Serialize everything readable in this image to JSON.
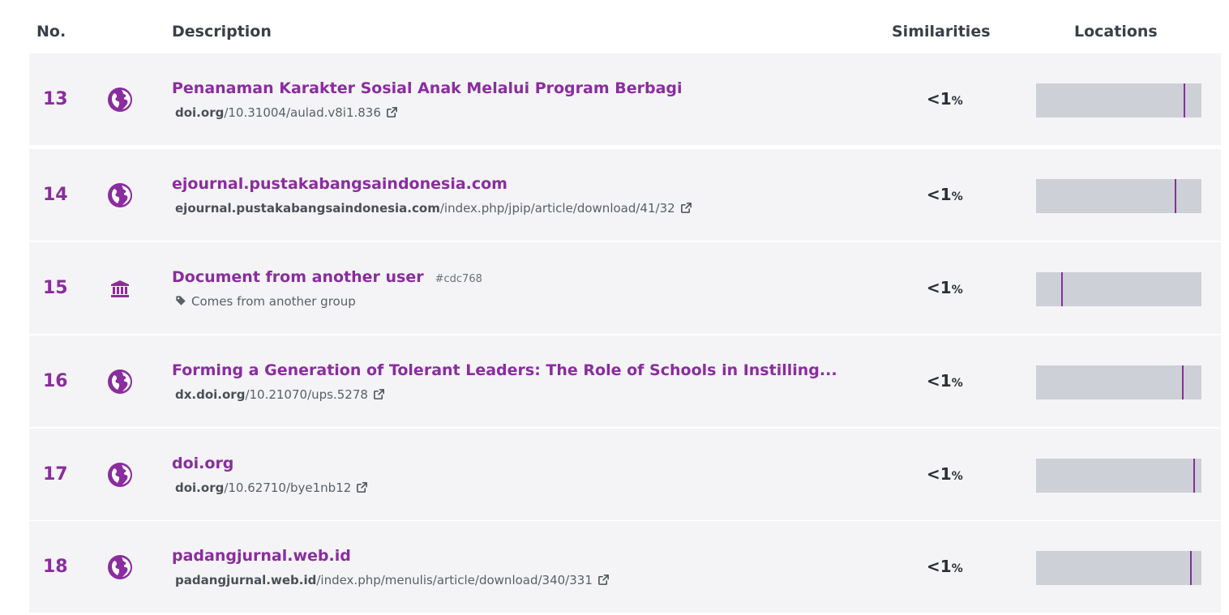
{
  "header": {
    "no": "No.",
    "description": "Description",
    "similarities": "Similarities",
    "locations": "Locations"
  },
  "colors": {
    "accent": "#8a2d9e",
    "row_bg": "#f4f4f6",
    "bar_bg": "#cdd0d6"
  },
  "rows": [
    {
      "no": "13",
      "icon": "globe-icon",
      "title": "Penanaman Karakter Sosial Anak Melalui Program Berbagi",
      "domain": "doi.org",
      "path": "/10.31004/aulad.v8i1.836",
      "similarity": "<1",
      "pct": "%",
      "location_fraction": 0.89
    },
    {
      "no": "14",
      "icon": "globe-icon",
      "title": "ejournal.pustakabangsaindonesia.com",
      "domain": "ejournal.pustakabangsaindonesia.com",
      "path": "/index.php/jpip/article/download/41/32",
      "similarity": "<1",
      "pct": "%",
      "location_fraction": 0.84
    },
    {
      "no": "15",
      "icon": "institution-icon",
      "title": "Document from another user",
      "hash": "#cdc768",
      "group_label": "Comes from another group",
      "similarity": "<1",
      "pct": "%",
      "location_fraction": 0.15
    },
    {
      "no": "16",
      "icon": "globe-icon",
      "title": "Forming a Generation of Tolerant Leaders: The Role of Schools in Instilling...",
      "domain": "dx.doi.org",
      "path": "/10.21070/ups.5278",
      "similarity": "<1",
      "pct": "%",
      "location_fraction": 0.88
    },
    {
      "no": "17",
      "icon": "globe-icon",
      "title": "doi.org",
      "domain": "doi.org",
      "path": "/10.62710/bye1nb12",
      "similarity": "<1",
      "pct": "%",
      "location_fraction": 0.95
    },
    {
      "no": "18",
      "icon": "globe-icon",
      "title": "padangjurnal.web.id",
      "domain": "padangjurnal.web.id",
      "path": "/index.php/menulis/article/download/340/331",
      "similarity": "<1",
      "pct": "%",
      "location_fraction": 0.93
    }
  ]
}
